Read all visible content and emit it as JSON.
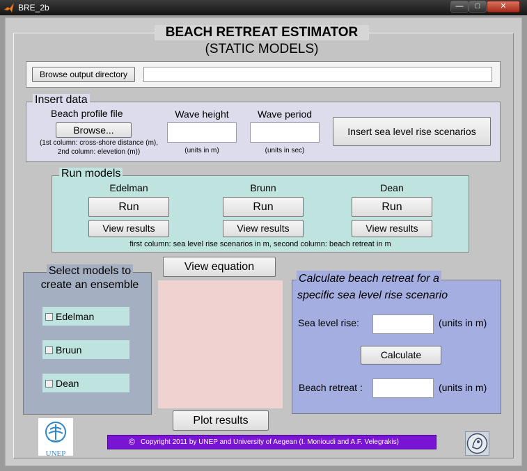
{
  "window": {
    "title": "BRE_2b",
    "min_glyph": "—",
    "max_glyph": "□",
    "close_glyph": "✕"
  },
  "header": {
    "title": "BEACH RETREAT ESTIMATOR",
    "subtitle": "(STATIC MODELS)"
  },
  "output": {
    "browse_label": "Browse output directory",
    "path_value": ""
  },
  "insert_data": {
    "legend": "Insert data",
    "profile_label": "Beach profile file",
    "browse_label": "Browse...",
    "profile_note_1": "(1st column: cross-shore distance (m),",
    "profile_note_2": "2nd column: elevetion (m))",
    "wave_height_label": "Wave height",
    "wave_height_value": "",
    "wave_height_units": "(units in m)",
    "wave_period_label": "Wave period",
    "wave_period_value": "",
    "wave_period_units": "(units in sec)",
    "slr_button": "Insert sea level rise scenarios"
  },
  "run_models": {
    "legend": "Run models",
    "models": [
      {
        "name": "Edelman",
        "run": "Run",
        "view": "View results"
      },
      {
        "name": "Brunn",
        "run": "Run",
        "view": "View results"
      },
      {
        "name": "Dean",
        "run": "Run",
        "view": "View results"
      }
    ],
    "note": "first column: sea level rise scenarios in m, second column: beach retreat in m"
  },
  "ensemble": {
    "legend_line1": "Select models to",
    "legend_line2": "create an ensemble",
    "options": [
      {
        "label": "Edelman",
        "checked": false
      },
      {
        "label": "Bruun",
        "checked": false
      },
      {
        "label": "Dean",
        "checked": false
      }
    ]
  },
  "view_equation": "View equation",
  "plot_results": "Plot results",
  "specific": {
    "legend_line1": "Calculate beach retreat for a",
    "legend_line2": "specific sea level rise scenario",
    "slr_label": "Sea level rise:",
    "slr_value": "",
    "slr_units": "(units in m)",
    "calculate": "Calculate",
    "retreat_label": "Beach retreat :",
    "retreat_value": "",
    "retreat_units": "(units in m)"
  },
  "footer": {
    "copyright_symbol": "©",
    "copyright": "Copyright 2011 by UNEP and University of Aegean (I. Monioudi and A.F. Velegrakis)",
    "unep_logo_text": "UNEP"
  },
  "colors": {
    "insert_panel": "#dcdcec",
    "run_panel": "#bfe3df",
    "ensemble_panel": "#a4b0c2",
    "ensemble_item": "#bfe3df",
    "equation_panel": "#f0d2d0",
    "specific_panel": "#a5aee0",
    "footer_bar": "#7a14d4",
    "unep_blue": "#2f86c8"
  }
}
